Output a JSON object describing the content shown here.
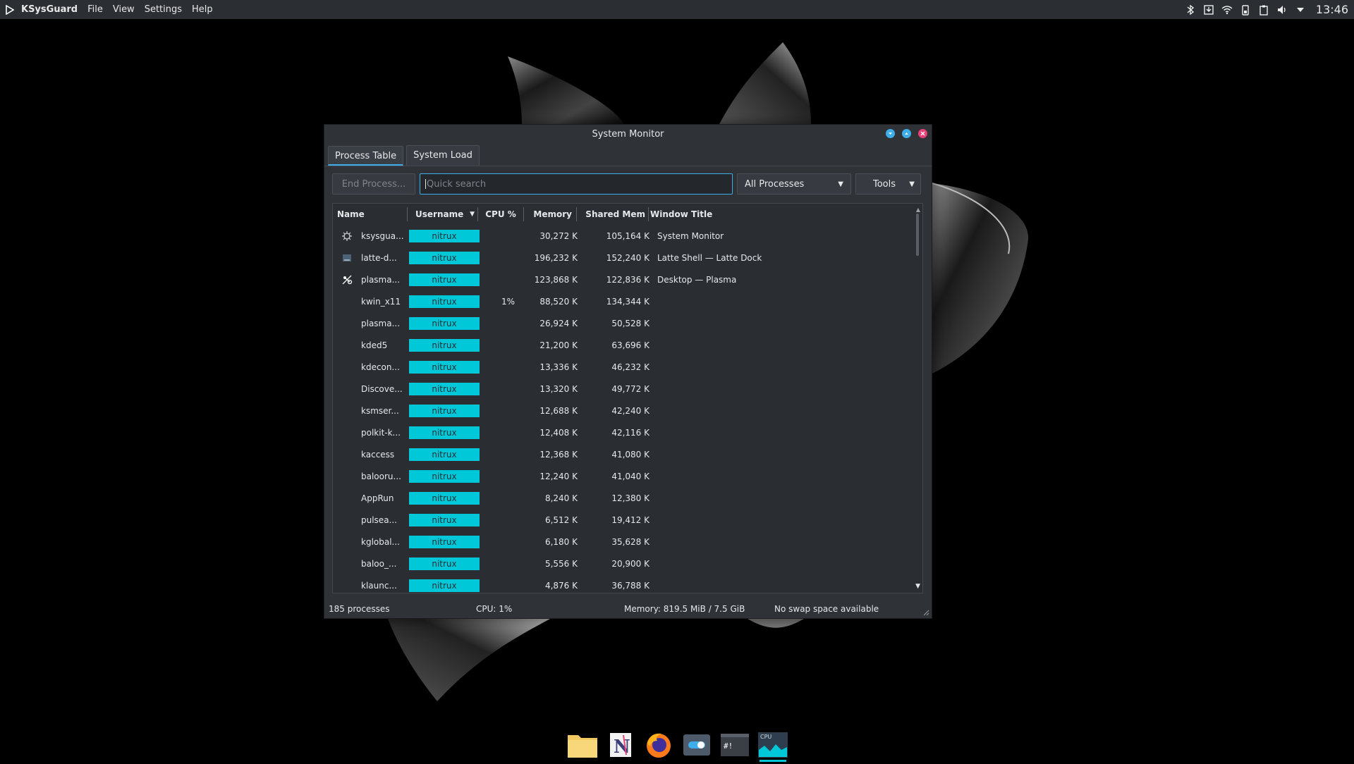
{
  "topbar": {
    "app_name": "KSysGuard",
    "menu": [
      "File",
      "View",
      "Settings",
      "Help"
    ],
    "clock": "13:46"
  },
  "window": {
    "title": "System Monitor",
    "tabs": [
      {
        "label": "Process Table",
        "active": true
      },
      {
        "label": "System Load",
        "active": false
      }
    ],
    "toolbar": {
      "end_process": "End Process...",
      "search_placeholder": "Quick search",
      "filter_selected": "All Processes",
      "tools": "Tools"
    },
    "columns": [
      "Name",
      "Username",
      "CPU %",
      "Memory",
      "Shared Mem",
      "Window Title"
    ],
    "rows": [
      {
        "name": "ksysgua...",
        "user": "nitrux",
        "cpu": "",
        "mem": "30,272 K",
        "shared": "105,164 K",
        "window": "System Monitor",
        "icon": "ksysguard-icon"
      },
      {
        "name": "latte-d...",
        "user": "nitrux",
        "cpu": "",
        "mem": "196,232 K",
        "shared": "152,240 K",
        "window": "Latte Shell — Latte Dock",
        "icon": "latte-dock-icon"
      },
      {
        "name": "plasma...",
        "user": "nitrux",
        "cpu": "",
        "mem": "123,868 K",
        "shared": "122,836 K",
        "window": "Desktop — Plasma",
        "icon": "plasma-icon"
      },
      {
        "name": "kwin_x11",
        "user": "nitrux",
        "cpu": "1%",
        "mem": "88,520 K",
        "shared": "134,344 K",
        "window": "",
        "icon": ""
      },
      {
        "name": "plasma...",
        "user": "nitrux",
        "cpu": "",
        "mem": "26,924 K",
        "shared": "50,528 K",
        "window": "",
        "icon": ""
      },
      {
        "name": "kded5",
        "user": "nitrux",
        "cpu": "",
        "mem": "21,200 K",
        "shared": "63,696 K",
        "window": "",
        "icon": ""
      },
      {
        "name": "kdecon...",
        "user": "nitrux",
        "cpu": "",
        "mem": "13,336 K",
        "shared": "46,232 K",
        "window": "",
        "icon": ""
      },
      {
        "name": "Discove...",
        "user": "nitrux",
        "cpu": "",
        "mem": "13,320 K",
        "shared": "49,772 K",
        "window": "",
        "icon": ""
      },
      {
        "name": "ksmser...",
        "user": "nitrux",
        "cpu": "",
        "mem": "12,688 K",
        "shared": "42,240 K",
        "window": "",
        "icon": ""
      },
      {
        "name": "polkit-k...",
        "user": "nitrux",
        "cpu": "",
        "mem": "12,408 K",
        "shared": "42,116 K",
        "window": "",
        "icon": ""
      },
      {
        "name": "kaccess",
        "user": "nitrux",
        "cpu": "",
        "mem": "12,368 K",
        "shared": "41,080 K",
        "window": "",
        "icon": ""
      },
      {
        "name": "balooru...",
        "user": "nitrux",
        "cpu": "",
        "mem": "12,240 K",
        "shared": "41,040 K",
        "window": "",
        "icon": ""
      },
      {
        "name": "AppRun",
        "user": "nitrux",
        "cpu": "",
        "mem": "8,240 K",
        "shared": "12,380 K",
        "window": "",
        "icon": ""
      },
      {
        "name": "pulsea...",
        "user": "nitrux",
        "cpu": "",
        "mem": "6,512 K",
        "shared": "19,412 K",
        "window": "",
        "icon": ""
      },
      {
        "name": "kglobal...",
        "user": "nitrux",
        "cpu": "",
        "mem": "6,180 K",
        "shared": "35,628 K",
        "window": "",
        "icon": ""
      },
      {
        "name": "baloo_...",
        "user": "nitrux",
        "cpu": "",
        "mem": "5,556 K",
        "shared": "20,900 K",
        "window": "",
        "icon": ""
      },
      {
        "name": "klaunc...",
        "user": "nitrux",
        "cpu": "",
        "mem": "4,876 K",
        "shared": "36,788 K",
        "window": "",
        "icon": ""
      }
    ],
    "status": {
      "processes": "185 processes",
      "cpu": "CPU: 1%",
      "memory": "Memory: 819.5 MiB / 7.5 GiB",
      "swap": "No swap space available"
    }
  },
  "dock": {
    "items": [
      "folder-icon",
      "nitrux-icon",
      "firefox-icon",
      "toggle-icon",
      "terminal-icon",
      "cpu-monitor-icon"
    ],
    "cpu_label": "CPU",
    "terminal_label": "#!"
  },
  "colors": {
    "accent": "#3daee9",
    "user_badge": "#00c8d8",
    "window_bg": "#2f3237"
  }
}
